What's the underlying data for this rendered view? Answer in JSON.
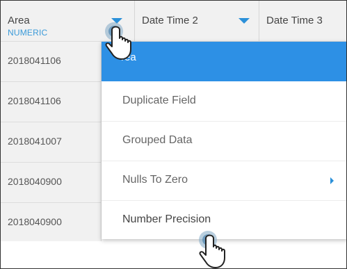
{
  "columns": [
    {
      "title": "Area",
      "type": "NUMERIC"
    },
    {
      "title": "Date Time 2"
    },
    {
      "title": "Date Time 3"
    }
  ],
  "rows": [
    {
      "area": "2018041106"
    },
    {
      "area": "2018041007"
    },
    {
      "area": "2018040900"
    },
    {
      "area": "2018040900"
    }
  ],
  "menu": {
    "items": [
      {
        "label": "rea",
        "state": "hovered"
      },
      {
        "label": "Duplicate Field"
      },
      {
        "label": "Grouped Data"
      },
      {
        "label": "Nulls To Zero",
        "has_submenu": true
      },
      {
        "label": "Number Precision"
      }
    ]
  },
  "colors": {
    "accent": "#2d90e5",
    "header_bg": "#f1f1f1",
    "type_label": "#3a9ad9"
  },
  "icons": {
    "cursor": "hand-pointer-icon",
    "submenu": "chevron-right-icon",
    "sort": "caret-down-icon"
  }
}
